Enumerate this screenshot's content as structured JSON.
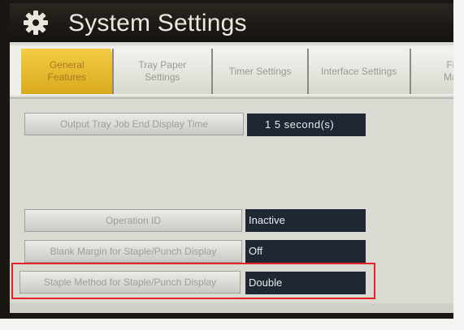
{
  "window": {
    "title": "System Settings",
    "icon": "gear-icon"
  },
  "tabs": [
    {
      "label": "General Features",
      "active": true
    },
    {
      "label": "Tray Paper Settings",
      "active": false
    },
    {
      "label": "Timer Settings",
      "active": false
    },
    {
      "label": "Interface Settings",
      "active": false
    },
    {
      "label": "Fi Ma",
      "active": false
    }
  ],
  "settings": [
    {
      "label": "Output Tray Job End Display Time",
      "value": "1 5  second(s)"
    },
    {
      "label": "Operation ID",
      "value": "Inactive"
    },
    {
      "label": "Blank Margin for Staple/Punch Display",
      "value": "Off"
    },
    {
      "label": "Staple Method for Staple/Punch Display",
      "value": "Double"
    }
  ],
  "colors": {
    "active_tab": "#e6b62c",
    "value_box": "#1f2733",
    "highlight": "#e8202a"
  }
}
